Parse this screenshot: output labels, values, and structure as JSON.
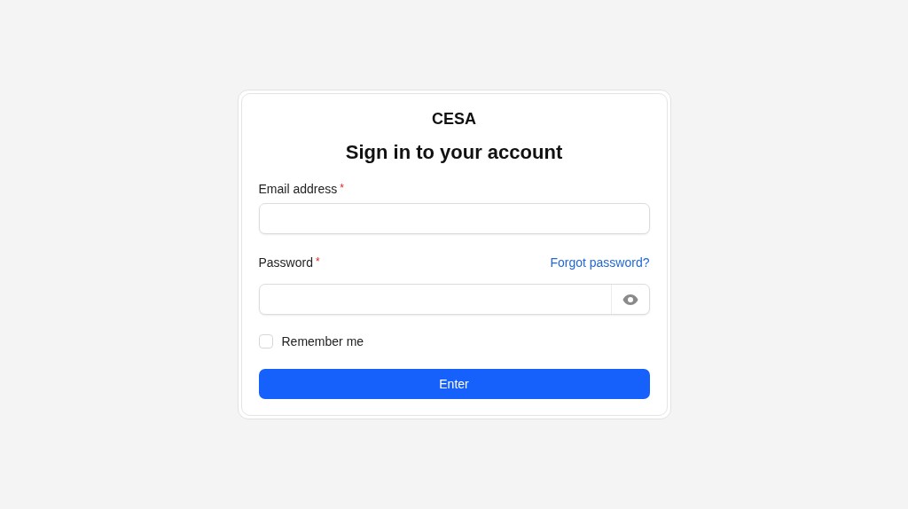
{
  "brand": "CESA",
  "title": "Sign in to your account",
  "email": {
    "label": "Email address",
    "required_mark": "*"
  },
  "password": {
    "label": "Password",
    "required_mark": "*",
    "forgot_link": "Forgot password?"
  },
  "remember": {
    "label": "Remember me",
    "checked": false
  },
  "submit": "Enter"
}
